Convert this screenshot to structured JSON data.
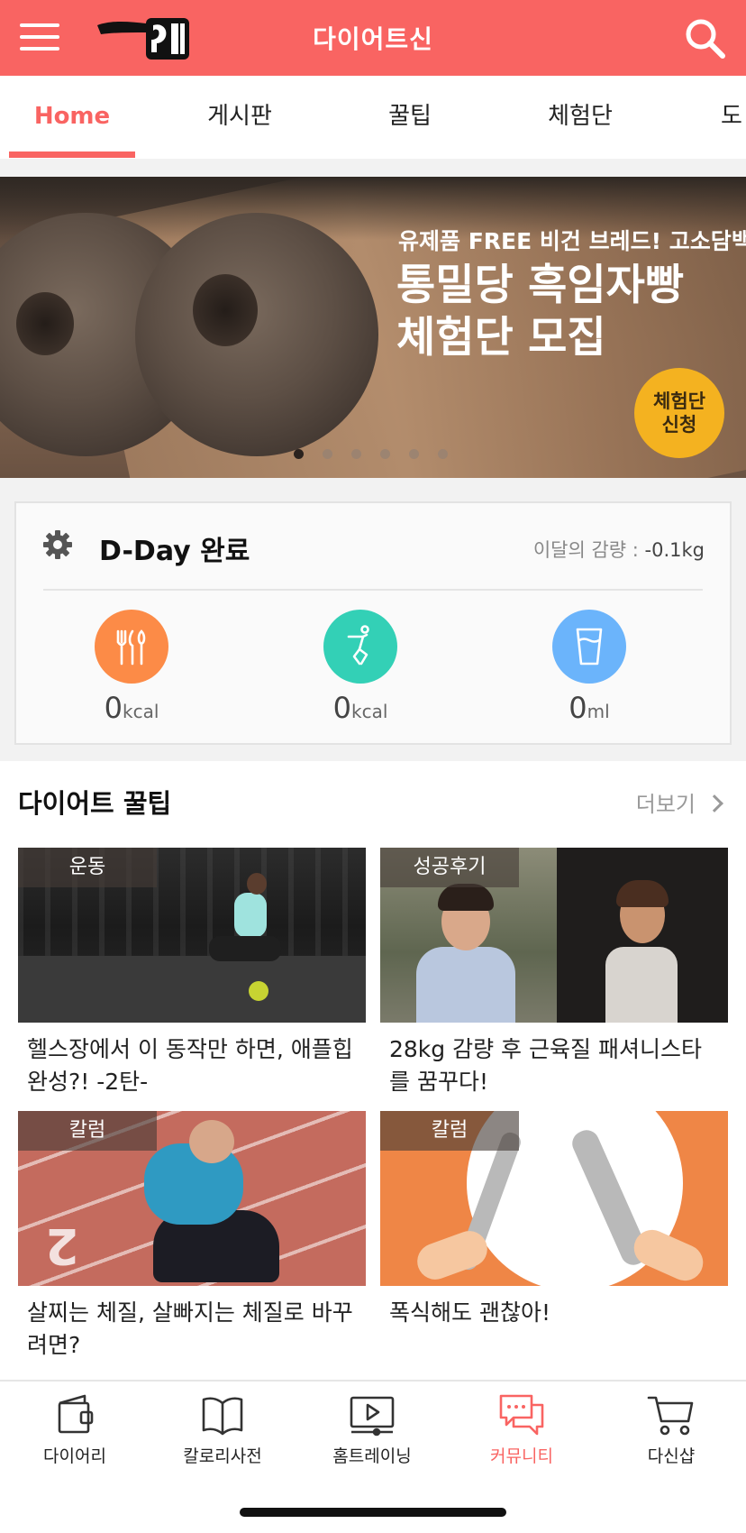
{
  "header": {
    "title": "다이어트신",
    "menu_icon": "hamburger-menu-icon",
    "search_icon": "search-icon",
    "brand_color": "#f96462"
  },
  "tabs": [
    {
      "label": "Home",
      "active": true
    },
    {
      "label": "게시판",
      "active": false
    },
    {
      "label": "꿀팁",
      "active": false
    },
    {
      "label": "체험단",
      "active": false
    },
    {
      "label": "도",
      "active": false
    }
  ],
  "banner": {
    "subtitle": "유제품 FREE 비건 브레드! 고소담백",
    "title_line1": "통밀당 흑임자빵",
    "title_line2": "체험단 모집",
    "badge_line1": "체험단",
    "badge_line2": "신청",
    "slides": 6,
    "active_slide": 1
  },
  "dday": {
    "title": "D-Day 완료",
    "loss_label": "이달의 감량 : ",
    "loss_value": "-0.1kg",
    "stats": [
      {
        "icon": "fork-knife-icon",
        "value": "0",
        "unit": "kcal",
        "color": "#fc8b47"
      },
      {
        "icon": "exercise-figure-icon",
        "value": "0",
        "unit": "kcal",
        "color": "#33d0b6"
      },
      {
        "icon": "water-cup-icon",
        "value": "0",
        "unit": "ml",
        "color": "#6bb4fb"
      }
    ]
  },
  "tips": {
    "title": "다이어트 꿀팁",
    "more_label": "더보기",
    "cards": [
      {
        "tag": "운동",
        "text": "헬스장에서 이 동작만 하면, 애플힙 완성?! -2탄-"
      },
      {
        "tag": "성공후기",
        "text": "28kg 감량 후 근육질 패셔니스타를 꿈꾸다!"
      },
      {
        "tag": "칼럼",
        "text": "살찌는 체질, 살빠지는 체질로 바꾸려면?"
      },
      {
        "tag": "칼럼",
        "text": "폭식해도 괜찮아!"
      }
    ]
  },
  "bottom_nav": [
    {
      "label": "다이어리",
      "icon": "diary-wallet-icon",
      "active": false
    },
    {
      "label": "칼로리사전",
      "icon": "open-book-icon",
      "active": false
    },
    {
      "label": "홈트레이닝",
      "icon": "video-play-icon",
      "active": false
    },
    {
      "label": "커뮤니티",
      "icon": "chat-bubbles-icon",
      "active": true
    },
    {
      "label": "다신샵",
      "icon": "shopping-cart-icon",
      "active": false
    }
  ]
}
